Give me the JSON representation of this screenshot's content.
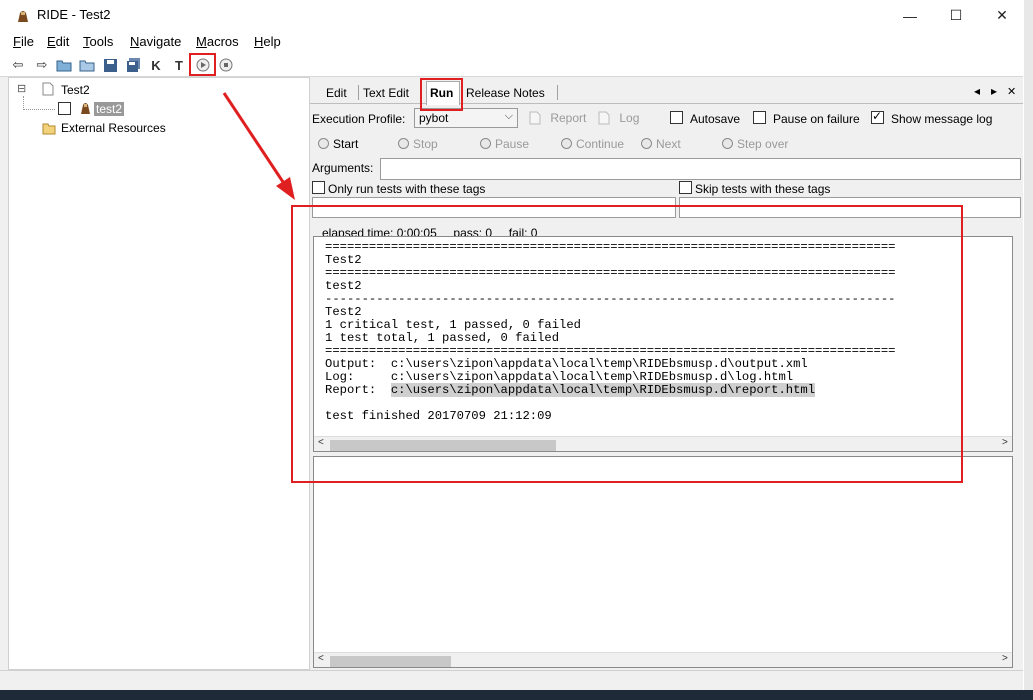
{
  "window": {
    "title": "RIDE - Test2",
    "minimize": "—",
    "maximize": "☐",
    "close": "✕"
  },
  "menu": [
    {
      "key": "F",
      "rest": "ile"
    },
    {
      "key": "E",
      "rest": "dit"
    },
    {
      "key": "T",
      "rest": "ools"
    },
    {
      "key": "N",
      "rest": "avigate"
    },
    {
      "key": "M",
      "rest": "acros"
    },
    {
      "key": "H",
      "rest": "elp"
    }
  ],
  "toolbar": {
    "icons": [
      "back-arrow-icon",
      "forward-arrow-icon",
      "open-suite-icon",
      "open-folder-icon",
      "save-icon",
      "save-all-icon",
      "keyword-search-icon",
      "test-search-icon",
      "run-icon",
      "stop-icon"
    ],
    "k_label": "K",
    "t_label": "T"
  },
  "tree": {
    "expander": "⊟",
    "suite": "Test2",
    "test": "test2",
    "resources": "External Resources"
  },
  "tabs": {
    "edit": "Edit",
    "text_edit": "Text Edit",
    "run": "Run",
    "release_notes": "Release Notes",
    "nav_left": "◂",
    "nav_right": "▸",
    "close": "✕"
  },
  "run": {
    "profile_label": "Execution Profile:",
    "profile_value": "pybot",
    "report_label": "Report",
    "log_label": "Log",
    "autosave_label": "Autosave",
    "autosave_checked": false,
    "pause_label": "Pause on failure",
    "pause_checked": false,
    "show_log_label": "Show message log",
    "show_log_checked": true,
    "start": "Start",
    "stop": "Stop",
    "pause": "Pause",
    "continue": "Continue",
    "next": "Next",
    "step_over": "Step over",
    "arguments_label": "Arguments:",
    "arguments_value": "",
    "only_tags_label": "Only run tests with these tags",
    "skip_tags_label": "Skip tests with these tags",
    "status": "elapsed time: 0:00:05     pass: 0     fail: 0",
    "console_before": "==============================================================================\nTest2\n==============================================================================\ntest2\n------------------------------------------------------------------------------\nTest2\n1 critical test, 1 passed, 0 failed\n1 test total, 1 passed, 0 failed\n==============================================================================\nOutput:  c:\\users\\zipon\\appdata\\local\\temp\\RIDEbsmusp.d\\output.xml\nLog:     c:\\users\\zipon\\appdata\\local\\temp\\RIDEbsmusp.d\\log.html\nReport:  ",
    "console_highlight": "c:\\users\\zipon\\appdata\\local\\temp\\RIDEbsmusp.d\\report.html",
    "console_after": "\n\ntest finished 20170709 21:12:09",
    "scroll_left": "<",
    "scroll_right": ">"
  },
  "colors": {
    "annotation": "#e02020",
    "window_bg": "#f0f0f0"
  }
}
